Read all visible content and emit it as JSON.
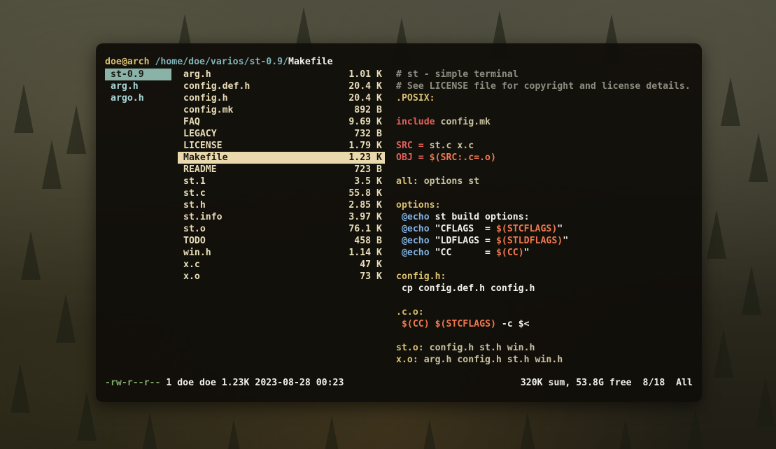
{
  "prompt": {
    "user": "doe",
    "at": "@",
    "host": "arch",
    "path": " /home/doe/varios/st-0.9/",
    "file": "Makefile"
  },
  "parent_column": [
    {
      "name": "st-0.9",
      "selected": true
    },
    {
      "name": "arg.h",
      "selected": false
    },
    {
      "name": "argo.h",
      "selected": false
    }
  ],
  "files": [
    {
      "name": "arg.h",
      "size": "1.01 K"
    },
    {
      "name": "config.def.h",
      "size": "20.4 K"
    },
    {
      "name": "config.h",
      "size": "20.4 K"
    },
    {
      "name": "config.mk",
      "size": "892 B"
    },
    {
      "name": "FAQ",
      "size": "9.69 K"
    },
    {
      "name": "LEGACY",
      "size": "732 B"
    },
    {
      "name": "LICENSE",
      "size": "1.79 K"
    },
    {
      "name": "Makefile",
      "size": "1.23 K",
      "selected": true
    },
    {
      "name": "README",
      "size": "723 B"
    },
    {
      "name": "st.1",
      "size": "3.5 K"
    },
    {
      "name": "st.c",
      "size": "55.8 K"
    },
    {
      "name": "st.h",
      "size": "2.85 K"
    },
    {
      "name": "st.info",
      "size": "3.97 K"
    },
    {
      "name": "st.o",
      "size": "76.1 K"
    },
    {
      "name": "TODO",
      "size": "458 B"
    },
    {
      "name": "win.h",
      "size": "1.14 K"
    },
    {
      "name": "x.c",
      "size": "47 K"
    },
    {
      "name": "x.o",
      "size": "73 K"
    }
  ],
  "preview": [
    [
      {
        "c": "cm",
        "t": "# st - simple terminal"
      }
    ],
    [
      {
        "c": "cm",
        "t": "# See LICENSE file for copyright and license details."
      }
    ],
    [
      {
        "c": "tg",
        "t": ".POSIX:"
      }
    ],
    [],
    [
      {
        "c": "kw",
        "t": "include "
      },
      {
        "c": "gr",
        "t": "config.mk"
      }
    ],
    [],
    [
      {
        "c": "kw",
        "t": "SRC = "
      },
      {
        "c": "gr",
        "t": "st.c x.c"
      }
    ],
    [
      {
        "c": "kw",
        "t": "OBJ = "
      },
      {
        "c": "vr",
        "t": "$(SRC:.c=.o)"
      }
    ],
    [],
    [
      {
        "c": "tg",
        "t": "all: "
      },
      {
        "c": "gr",
        "t": "options st"
      }
    ],
    [],
    [
      {
        "c": "tg",
        "t": "options:"
      }
    ],
    [
      {
        "c": "tx",
        "t": " "
      },
      {
        "c": "ec",
        "t": "@echo"
      },
      {
        "c": "tx",
        "t": " st build options:"
      }
    ],
    [
      {
        "c": "tx",
        "t": " "
      },
      {
        "c": "ec",
        "t": "@echo"
      },
      {
        "c": "tx",
        "t": " \"CFLAGS  = "
      },
      {
        "c": "vr",
        "t": "$(STCFLAGS)"
      },
      {
        "c": "tx",
        "t": "\""
      }
    ],
    [
      {
        "c": "tx",
        "t": " "
      },
      {
        "c": "ec",
        "t": "@echo"
      },
      {
        "c": "tx",
        "t": " \"LDFLAGS = "
      },
      {
        "c": "vr",
        "t": "$(STLDFLAGS)"
      },
      {
        "c": "tx",
        "t": "\""
      }
    ],
    [
      {
        "c": "tx",
        "t": " "
      },
      {
        "c": "ec",
        "t": "@echo"
      },
      {
        "c": "tx",
        "t": " \"CC      = "
      },
      {
        "c": "vr",
        "t": "$(CC)"
      },
      {
        "c": "tx",
        "t": "\""
      }
    ],
    [],
    [
      {
        "c": "tg",
        "t": "config.h:"
      }
    ],
    [
      {
        "c": "tx",
        "t": " cp config.def.h config.h"
      }
    ],
    [],
    [
      {
        "c": "tg",
        "t": ".c.o:"
      }
    ],
    [
      {
        "c": "tx",
        "t": " "
      },
      {
        "c": "vr",
        "t": "$(CC)"
      },
      {
        "c": "tx",
        "t": " "
      },
      {
        "c": "vr",
        "t": "$(STCFLAGS)"
      },
      {
        "c": "tx",
        "t": " -c $<"
      }
    ],
    [],
    [
      {
        "c": "tg",
        "t": "st.o: "
      },
      {
        "c": "gr",
        "t": "config.h st.h win.h"
      }
    ],
    [
      {
        "c": "tg",
        "t": "x.o: "
      },
      {
        "c": "gr",
        "t": "arg.h config.h st.h win.h"
      }
    ]
  ],
  "status": {
    "permissions": "-rw-r--r--",
    "details": " 1 doe doe 1.23K 2023-08-28 00:23",
    "disk": "320K sum, 53.8G free",
    "position": "8/18",
    "scroll": "All"
  }
}
